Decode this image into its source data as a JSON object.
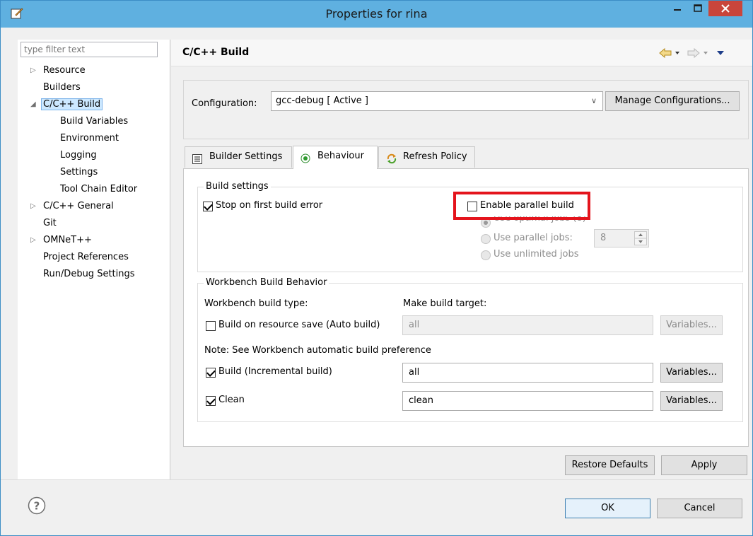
{
  "window": {
    "title": "Properties for rina"
  },
  "filter": {
    "placeholder": "type filter text"
  },
  "tree": [
    {
      "label": "Resource",
      "arrow": "▷",
      "indent": 0
    },
    {
      "label": "Builders",
      "arrow": "",
      "indent": 0
    },
    {
      "label": "C/C++ Build",
      "arrow": "◢",
      "indent": 0,
      "selected": true
    },
    {
      "label": "Build Variables",
      "arrow": "",
      "indent": 1
    },
    {
      "label": "Environment",
      "arrow": "",
      "indent": 1
    },
    {
      "label": "Logging",
      "arrow": "",
      "indent": 1
    },
    {
      "label": "Settings",
      "arrow": "",
      "indent": 1
    },
    {
      "label": "Tool Chain Editor",
      "arrow": "",
      "indent": 1
    },
    {
      "label": "C/C++ General",
      "arrow": "▷",
      "indent": 0
    },
    {
      "label": "Git",
      "arrow": "",
      "indent": 0
    },
    {
      "label": "OMNeT++",
      "arrow": "▷",
      "indent": 0
    },
    {
      "label": "Project References",
      "arrow": "",
      "indent": 0
    },
    {
      "label": "Run/Debug Settings",
      "arrow": "",
      "indent": 0
    }
  ],
  "page": {
    "title": "C/C++ Build",
    "config_label": "Configuration:",
    "config_value": "gcc-debug  [ Active ]",
    "manage_button": "Manage Configurations..."
  },
  "tabs": [
    {
      "label": "Builder Settings",
      "icon": "list-icon",
      "active": false
    },
    {
      "label": "Behaviour",
      "icon": "radio-dot-icon",
      "active": true
    },
    {
      "label": "Refresh Policy",
      "icon": "refresh-icon",
      "active": false
    }
  ],
  "build_settings": {
    "legend": "Build settings",
    "stop_on_error": {
      "label": "Stop on first build error",
      "checked": true
    },
    "parallel": {
      "label": "Enable parallel build",
      "checked": false
    },
    "optimal_jobs": "Use optimal jobs (8)",
    "parallel_jobs": "Use parallel jobs:",
    "parallel_jobs_value": "8",
    "unlimited_jobs": "Use unlimited jobs"
  },
  "workbench": {
    "legend": "Workbench Build Behavior",
    "build_type_label": "Workbench build type:",
    "make_target_label": "Make build target:",
    "auto_build": {
      "label": "Build on resource save (Auto build)",
      "checked": false,
      "value": "all"
    },
    "note": "Note: See Workbench automatic build preference",
    "incremental": {
      "label": "Build (Incremental build)",
      "checked": true,
      "value": "all"
    },
    "clean": {
      "label": "Clean",
      "checked": true,
      "value": "clean"
    },
    "variables_button": "Variables..."
  },
  "buttons": {
    "restore_defaults": "Restore Defaults",
    "apply": "Apply",
    "ok": "OK",
    "cancel": "Cancel"
  },
  "colors": {
    "titlebar": "#5fb0e0",
    "close": "#c9453b",
    "highlight": "#e4141c",
    "selection": "#cce8ff"
  }
}
